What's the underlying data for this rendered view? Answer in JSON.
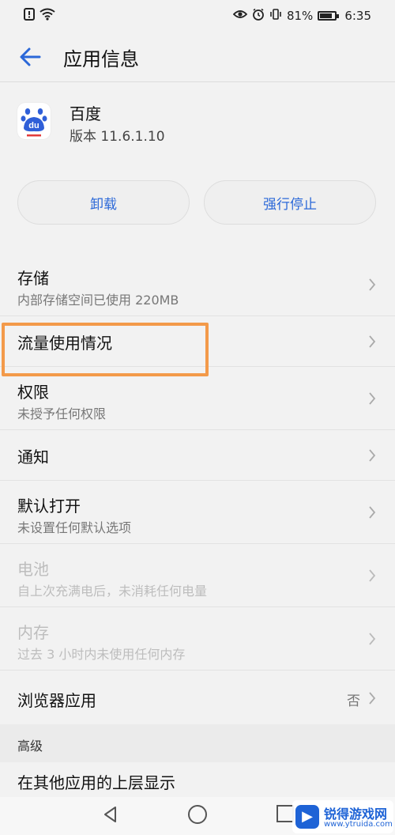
{
  "status_bar": {
    "left_icons": [
      "alert-icon",
      "wifi-icon"
    ],
    "right_icons": [
      "eye-icon",
      "alarm-icon",
      "vibrate-icon"
    ],
    "battery_percent": "81%",
    "battery_level": 0.81,
    "time": "6:35"
  },
  "header": {
    "title": "应用信息"
  },
  "app": {
    "name": "百度",
    "version": "版本 11.6.1.10",
    "icon_text": "du"
  },
  "actions": {
    "uninstall": "卸载",
    "force_stop": "强行停止"
  },
  "list": [
    {
      "title": "存储",
      "subtitle": "内部存储空间已使用 220MB"
    },
    {
      "title": "流量使用情况"
    },
    {
      "title": "权限",
      "subtitle": "未授予任何权限"
    },
    {
      "title": "通知"
    },
    {
      "title": "默认打开",
      "subtitle": "未设置任何默认选项"
    },
    {
      "title": "电池",
      "subtitle": "自上次充满电后，未消耗任何电量"
    },
    {
      "title": "内存",
      "subtitle": "过去 3 小时内未使用任何内存"
    },
    {
      "title": "浏览器应用",
      "value": "否"
    }
  ],
  "section": {
    "label": "高级"
  },
  "advanced": {
    "title": "在其他应用的上层显示"
  },
  "watermark": {
    "name": "锐得游戏网",
    "url": "www.ytruida.com"
  },
  "colors": {
    "accent": "#2b68d8",
    "highlight": "#f39a4a"
  }
}
